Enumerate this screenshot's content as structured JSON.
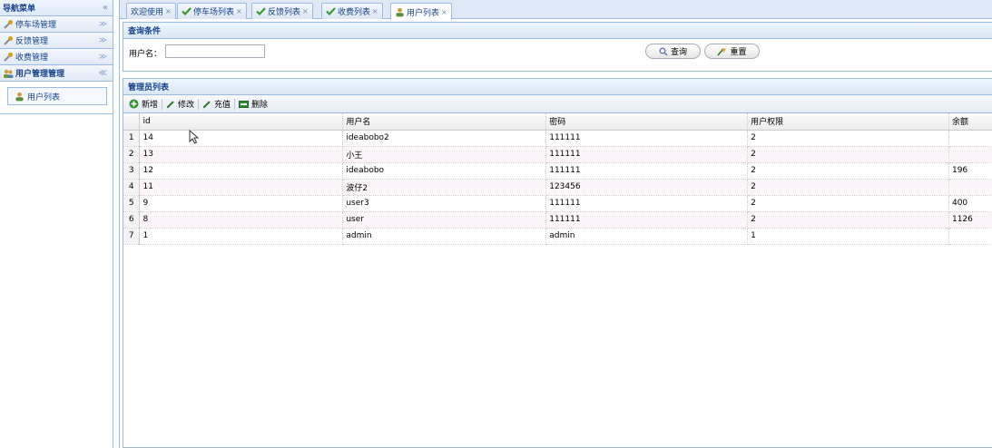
{
  "nav": {
    "title": "导航菜单",
    "collapse_glyph": "«",
    "sections": [
      {
        "label": "停车场管理",
        "chevron": "≫"
      },
      {
        "label": "反馈管理",
        "chevron": "≫"
      },
      {
        "label": "收费管理",
        "chevron": "≫"
      },
      {
        "label": "用户管理管理",
        "chevron": "≪"
      }
    ],
    "links": [
      {
        "label": "用户列表"
      }
    ]
  },
  "tabs": [
    {
      "label": "欢迎使用",
      "close": "×"
    },
    {
      "label": "停车场列表",
      "close": "×"
    },
    {
      "label": "反馈列表",
      "close": "×"
    },
    {
      "label": "收费列表",
      "close": "×"
    },
    {
      "label": "用户列表",
      "close": "×"
    }
  ],
  "query": {
    "title": "查询条件",
    "username_label": "用户名：",
    "username_value": "",
    "search_button": "查询",
    "reset_button": "重置"
  },
  "grid": {
    "title": "管理员列表",
    "toolbar": {
      "add": "新增",
      "edit": "修改",
      "recharge": "充值",
      "delete": "删除"
    },
    "columns": [
      "id",
      "用户名",
      "密码",
      "用户权限",
      "余额"
    ],
    "rows": [
      {
        "n": "1",
        "id": "14",
        "username": "ideabobo2",
        "password": "111111",
        "role": "2",
        "balance": ""
      },
      {
        "n": "2",
        "id": "13",
        "username": "小王",
        "password": "111111",
        "role": "2",
        "balance": ""
      },
      {
        "n": "3",
        "id": "12",
        "username": "ideabobo",
        "password": "111111",
        "role": "2",
        "balance": "196"
      },
      {
        "n": "4",
        "id": "11",
        "username": "波仔2",
        "password": "123456",
        "role": "2",
        "balance": ""
      },
      {
        "n": "5",
        "id": "9",
        "username": "user3",
        "password": "111111",
        "role": "2",
        "balance": "400"
      },
      {
        "n": "6",
        "id": "8",
        "username": "user",
        "password": "111111",
        "role": "2",
        "balance": "1126"
      },
      {
        "n": "7",
        "id": "1",
        "username": "admin",
        "password": "admin",
        "role": "1",
        "balance": ""
      }
    ]
  },
  "colors": {
    "border": "#99bbe8",
    "header_text": "#15428b",
    "alt_row": "#fbf4f8",
    "check_green": "#3b9a2c"
  }
}
